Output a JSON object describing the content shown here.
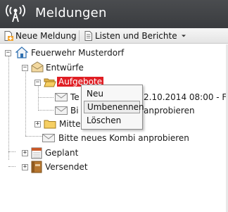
{
  "header": {
    "title": "Meldungen",
    "icon": "antenna-icon"
  },
  "toolbar": {
    "new_message": "Neue Meldung",
    "lists_reports": "Listen und Berichte"
  },
  "tree": {
    "root": "Feuerwehr Musterdorf",
    "drafts": "Entwürfe",
    "callouts": "Aufgebote",
    "callout_item1": "Te",
    "callout_item1_suffix": "2.10.2014 08:00 - F",
    "callout_item2": "Bi",
    "callout_item2_suffix": "anprobieren",
    "notices": "Mitteil",
    "draft_item": "Bitte neues Kombi anprobieren",
    "planned": "Geplant",
    "sent": "Versendet"
  },
  "context_menu": {
    "items": [
      "Neu",
      "Umbenennen",
      "Löschen"
    ]
  },
  "colors": {
    "header_bg": "#3f4144",
    "selected_bg": "#e01e24"
  }
}
